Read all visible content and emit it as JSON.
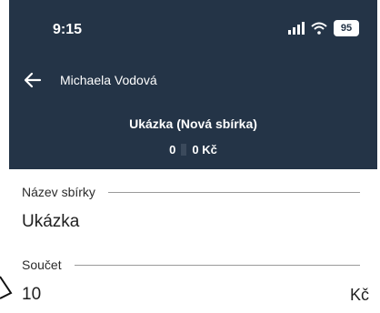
{
  "status_bar": {
    "time": "9:15",
    "battery": "95"
  },
  "app_bar": {
    "title": "Michaela Vodová"
  },
  "header": {
    "collection_title": "Ukázka (Nová sbírka)",
    "count": "0",
    "amount": "0 Kč"
  },
  "form": {
    "name_field": {
      "label": "Název sbírky",
      "value": "Ukázka"
    },
    "sum_field": {
      "label": "Součet",
      "value": "10",
      "currency": "Kč"
    }
  },
  "colors": {
    "header_background": "#243447",
    "text_on_header": "#ffffff"
  }
}
